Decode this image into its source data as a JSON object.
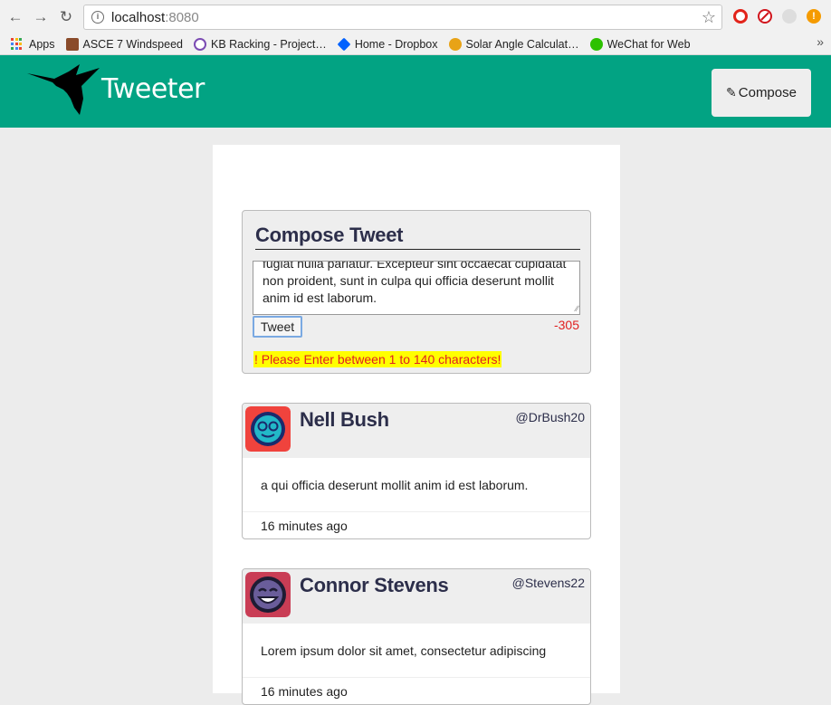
{
  "browser": {
    "url_host": "localhost",
    "url_port": ":8080",
    "bookmarks": [
      {
        "label": "Apps"
      },
      {
        "label": "ASCE 7 Windspeed"
      },
      {
        "label": "KB Racking - Project…"
      },
      {
        "label": "Home - Dropbox"
      },
      {
        "label": "Solar Angle Calculat…"
      },
      {
        "label": "WeChat for Web"
      }
    ],
    "more": "»"
  },
  "header": {
    "brand": "Tweeter",
    "compose_label": "Compose"
  },
  "compose": {
    "title": "Compose Tweet",
    "text_line1": "fugiat nulla pariatur. Excepteur sint occaecat cupidatat",
    "text_line2": "non proident, sunt in culpa qui officia deserunt mollit",
    "text_line3": "anim id est laborum.",
    "tweet_button": "Tweet",
    "counter": "-305",
    "error": "! Please Enter between 1 to 140 characters!"
  },
  "tweets": [
    {
      "name": "Nell Bush",
      "handle": "@DrBush20",
      "body": "a qui officia deserunt mollit anim id est laborum.",
      "time": "16 minutes ago",
      "avatar_color": "#f0433d"
    },
    {
      "name": "Connor Stevens",
      "handle": "@Stevens22",
      "body": "Lorem ipsum dolor sit amet, consectetur adipiscing",
      "time": "16 minutes ago",
      "avatar_color": "#c93d55"
    }
  ],
  "colors": {
    "appbar": "#02a383",
    "title_text": "#2c2e4a",
    "error_bg": "#ffff00",
    "error_text": "#e02020"
  }
}
